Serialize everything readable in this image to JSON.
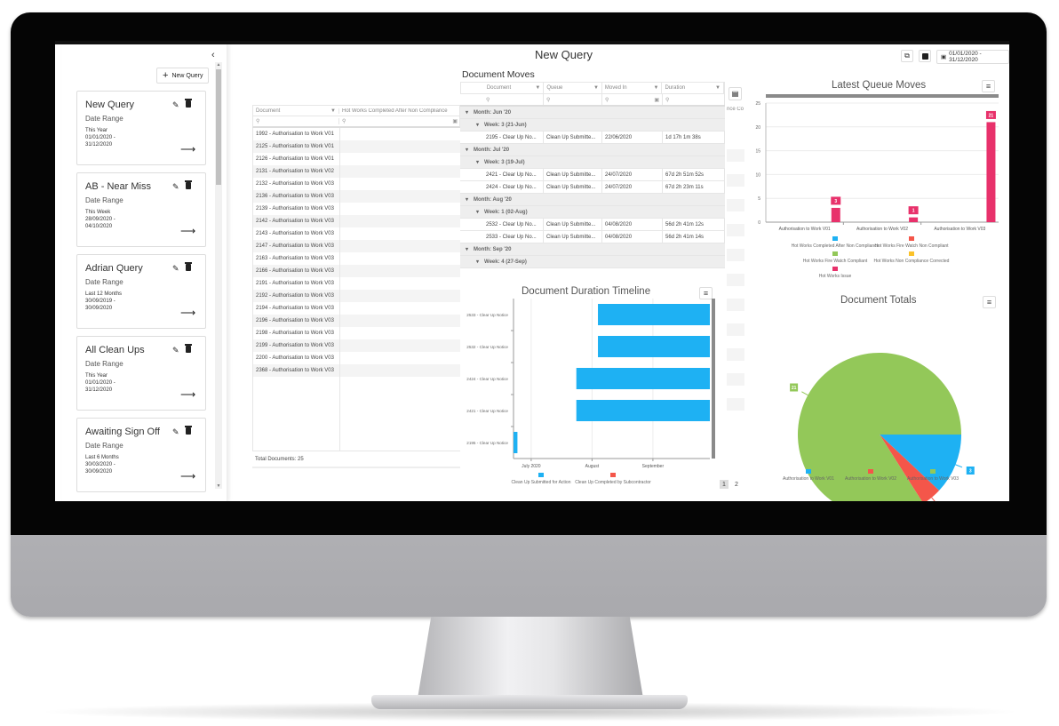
{
  "page": {
    "title": "New Query"
  },
  "header": {
    "date_range": "01/01/2020 - 31/12/2020",
    "export_icon": "external-link-icon",
    "save_icon": "save-icon",
    "calendar_icon": "calendar-icon"
  },
  "sidebar": {
    "collapse_glyph": "‹",
    "new_query_label": "New Query",
    "queries": [
      {
        "title": "New Query",
        "label": "Date Range",
        "period": "This Year",
        "from": "01/01/2020 -",
        "to": "31/12/2020"
      },
      {
        "title": "AB - Near Miss",
        "label": "Date Range",
        "period": "This Week",
        "from": "28/09/2020 -",
        "to": "04/10/2020"
      },
      {
        "title": "Adrian Query",
        "label": "Date Range",
        "period": "Last 12 Months",
        "from": "30/09/2019 -",
        "to": "30/09/2020"
      },
      {
        "title": "All Clean Ups",
        "label": "Date Range",
        "period": "This Year",
        "from": "01/01/2020 -",
        "to": "31/12/2020"
      },
      {
        "title": "Awaiting Sign Off",
        "label": "Date Range",
        "period": "Last 6 Months",
        "from": "30/03/2020 -",
        "to": "30/09/2020"
      }
    ]
  },
  "documents_grid": {
    "columns": [
      "Document",
      "Hot Works Completed After Non Compliance"
    ],
    "rows": [
      "1992 - Authorisation to Work V01",
      "2125 - Authorisation to Work V01",
      "2126 - Authorisation to Work V01",
      "2131 - Authorisation to Work V02",
      "2132 - Authorisation to Work V03",
      "2136 - Authorisation to Work V03",
      "2139 - Authorisation to Work V03",
      "2142 - Authorisation to Work V03",
      "2143 - Authorisation to Work V03",
      "2147 - Authorisation to Work V03",
      "2163 - Authorisation to Work V03",
      "2166 - Authorisation to Work V03",
      "2191 - Authorisation to Work V03",
      "2192 - Authorisation to Work V03",
      "2194 - Authorisation to Work V03",
      "2196 - Authorisation to Work V03",
      "2198 - Authorisation to Work V03",
      "2199 - Authorisation to Work V03",
      "2200 - Authorisation to Work V03",
      "2368 - Authorisation to Work V03"
    ],
    "footer": "Total Documents: 25",
    "hidden_column_fragment": "nce Co",
    "pager": [
      "1",
      "2"
    ]
  },
  "document_moves": {
    "title": "Document Moves",
    "columns": [
      "Document",
      "Queue",
      "Moved In",
      "Duration"
    ],
    "rows": [
      {
        "type": "month",
        "label": "Month: Jun '20"
      },
      {
        "type": "week",
        "label": "Week: 3 (21-Jun)"
      },
      {
        "type": "data",
        "cells": [
          "2195 - Clear Up No...",
          "Clean Up Submitte...",
          "22/06/2020",
          "1d 17h 1m 38s"
        ]
      },
      {
        "type": "month",
        "label": "Month: Jul '20"
      },
      {
        "type": "week",
        "label": "Week: 3 (19-Jul)"
      },
      {
        "type": "data",
        "cells": [
          "2421 - Clear Up No...",
          "Clean Up Submitte...",
          "24/07/2020",
          "67d 2h 51m 52s"
        ]
      },
      {
        "type": "data",
        "cells": [
          "2424 - Clear Up No...",
          "Clean Up Submitte...",
          "24/07/2020",
          "67d 2h 23m 11s"
        ]
      },
      {
        "type": "month",
        "label": "Month: Aug '20"
      },
      {
        "type": "week",
        "label": "Week: 1 (02-Aug)"
      },
      {
        "type": "data",
        "cells": [
          "2532 - Clear Up No...",
          "Clean Up Submitte...",
          "04/08/2020",
          "56d 2h 41m 12s"
        ]
      },
      {
        "type": "data",
        "cells": [
          "2533 - Clear Up No...",
          "Clean Up Submitte...",
          "04/08/2020",
          "56d 2h 41m 14s"
        ]
      },
      {
        "type": "month",
        "label": "Month: Sep '20"
      },
      {
        "type": "week",
        "label": "Week: 4 (27-Sep)"
      }
    ]
  },
  "chart_data": [
    {
      "type": "bar",
      "title": "Latest Queue Moves",
      "categories": [
        "Authorisation to Work V01",
        "Authorisation to Work V02",
        "Authorisation to Work V03"
      ],
      "series": [
        {
          "name": "Hot Works Completed After Non Compliance",
          "color": "#1eb1f3",
          "values": [
            0,
            0,
            0
          ]
        },
        {
          "name": "Hot Works Fire Watch Non Compliant",
          "color": "#f4564a",
          "values": [
            0,
            0,
            0
          ]
        },
        {
          "name": "Hot Works Fire Watch Compliant",
          "color": "#93c859",
          "values": [
            0,
            0,
            0
          ]
        },
        {
          "name": "Hot Works Non Compliance Corrected",
          "color": "#fbc22a",
          "values": [
            0,
            0,
            0
          ]
        },
        {
          "name": "Hot Works Issue",
          "color": "#e8316b",
          "values": [
            3,
            1,
            21
          ]
        }
      ],
      "ylim": [
        0,
        25
      ],
      "yticks": [
        0,
        5,
        10,
        15,
        20,
        25
      ],
      "grid": true,
      "legend": "bottom"
    },
    {
      "type": "bar",
      "orientation": "horizontal-range",
      "title": "Document Duration Timeline",
      "categories": [
        "2533 - Clear Up Notice",
        "2532 - Clear Up Notice",
        "2424 - Clear Up Notice",
        "2421 - Clear Up Notice",
        "2195 - Clear Up Notice"
      ],
      "series": [
        {
          "name": "Clean Up Submitted for Action",
          "color": "#1eb1f3",
          "ranges": [
            [
              "2020-08-04",
              "2020-09-30"
            ],
            [
              "2020-08-04",
              "2020-09-30"
            ],
            [
              "2020-07-24",
              "2020-09-30"
            ],
            [
              "2020-07-24",
              "2020-09-30"
            ],
            [
              "2020-06-22",
              "2020-06-24"
            ]
          ]
        },
        {
          "name": "Clean Up Completed by Subcontractor",
          "color": "#f4564a",
          "ranges": []
        }
      ],
      "xlim": [
        "2020-06-22",
        "2020-09-30"
      ],
      "xticks": [
        {
          "date": "2020-07-01",
          "label": "July 2020"
        },
        {
          "date": "2020-08-01",
          "label": "August"
        },
        {
          "date": "2020-09-01",
          "label": "September"
        }
      ],
      "legend": "bottom"
    },
    {
      "type": "pie",
      "title": "Document Totals",
      "labels": [
        "Authorisation to Work V01",
        "Authorisation to Work V02",
        "Authorisation to Work V03"
      ],
      "values": [
        3,
        1,
        21
      ],
      "colors": [
        "#1eb1f3",
        "#f4564a",
        "#93c859"
      ],
      "legend": "bottom"
    }
  ]
}
